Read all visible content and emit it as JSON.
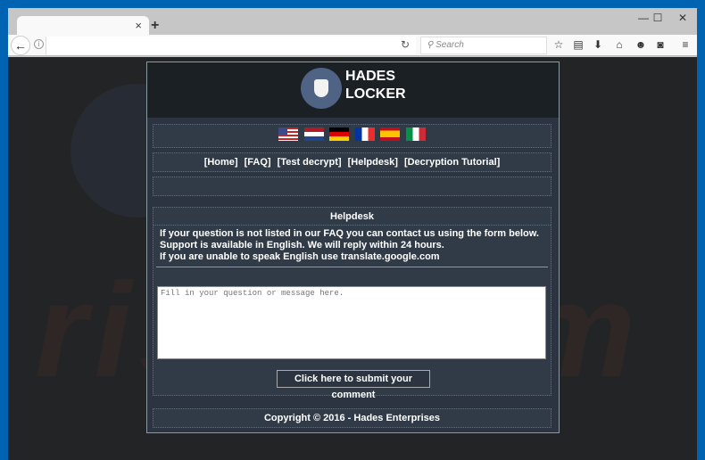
{
  "browser": {
    "tab_close": "×",
    "new_tab": "+",
    "minimize": "—",
    "maximize": "☐",
    "close": "✕",
    "back": "←",
    "info": "i",
    "reload": "↻",
    "search_placeholder": "Search",
    "toolbar_icons": [
      "star-icon",
      "clipboard-icon",
      "download-icon",
      "home-icon",
      "chat-icon",
      "pocket-icon",
      "menu-icon"
    ]
  },
  "site": {
    "brand_line1": "HADES",
    "brand_line2": "LOCKER",
    "flags": [
      "US",
      "NL",
      "DE",
      "FR",
      "ES",
      "IT"
    ],
    "nav": [
      "[Home]",
      "[FAQ]",
      "[Test decrypt]",
      "[Helpdesk]",
      "[Decryption Tutorial]"
    ],
    "helpdesk": {
      "title": "Helpdesk",
      "line1": "If your question is not listed in our FAQ you can contact us using the form below.",
      "line2": "Support is available in English. We will reply within 24 hours.",
      "line3_prefix": "If you are unable to speak English use ",
      "line3_link": "translate.google.com",
      "textarea_placeholder": "Fill in your question or message here.",
      "submit_label": "Click here to submit your comment"
    },
    "footer": "Copyright © 2016 - Hades Enterprises"
  }
}
